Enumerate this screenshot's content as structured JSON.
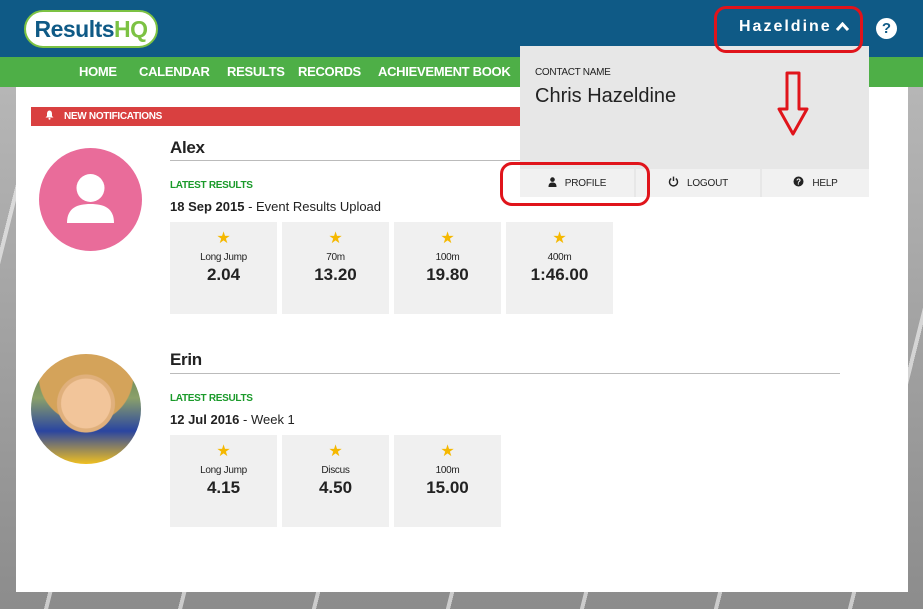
{
  "header": {
    "logo_part1": "Results",
    "logo_part2": "HQ",
    "user_menu_label": "Hazeldine",
    "help_icon_glyph": "?"
  },
  "nav": {
    "items": [
      "HOME",
      "CALENDAR",
      "RESULTS",
      "RECORDS",
      "ACHIEVEMENT BOOK"
    ]
  },
  "notifications": {
    "label": "NEW NOTIFICATIONS"
  },
  "children": [
    {
      "name": "Alex",
      "latest_label": "LATEST RESULTS",
      "date": "18 Sep 2015",
      "event_suffix": " - Event Results Upload",
      "results": [
        {
          "event": "Long Jump",
          "value": "2.04"
        },
        {
          "event": "70m",
          "value": "13.20"
        },
        {
          "event": "100m",
          "value": "19.80"
        },
        {
          "event": "400m",
          "value": "1:46.00"
        }
      ]
    },
    {
      "name": "Erin",
      "latest_label": "LATEST RESULTS",
      "date": "12 Jul 2016",
      "event_suffix": " - Week 1",
      "results": [
        {
          "event": "Long Jump",
          "value": "4.15"
        },
        {
          "event": "Discus",
          "value": "4.50"
        },
        {
          "event": "100m",
          "value": "15.00"
        }
      ]
    }
  ],
  "dropdown": {
    "contact_label": "CONTACT NAME",
    "contact_name": "Chris Hazeldine",
    "profile": "PROFILE",
    "logout": "LOGOUT",
    "help": "HELP"
  },
  "colors": {
    "header": "#0f5a86",
    "nav": "#4eaf47",
    "notification": "#d94040",
    "annotation": "#e0141b",
    "star": "#f5b800"
  }
}
